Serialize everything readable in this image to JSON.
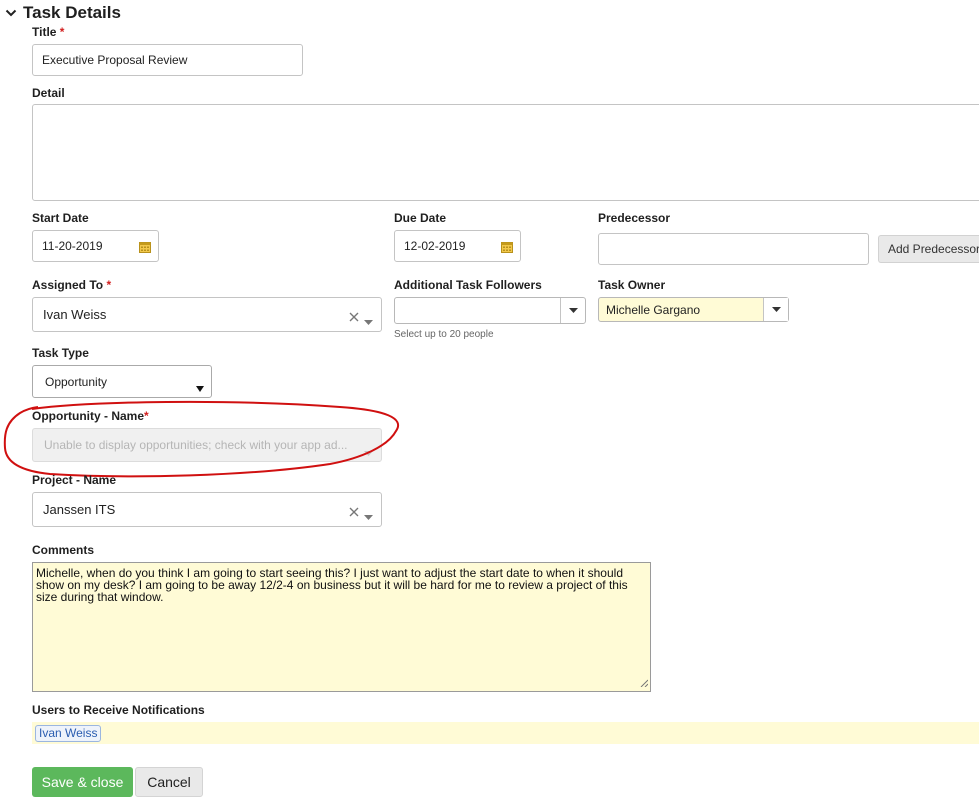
{
  "section": {
    "title": "Task Details"
  },
  "required_mark": "*",
  "title_field": {
    "label": "Title",
    "value": "Executive Proposal Review"
  },
  "detail_field": {
    "label": "Detail",
    "value": ""
  },
  "start_date": {
    "label": "Start Date",
    "value": "11-20-2019"
  },
  "due_date": {
    "label": "Due Date",
    "value": "12-02-2019"
  },
  "predecessor": {
    "label": "Predecessor",
    "value": "",
    "add_button": "Add Predecessors"
  },
  "assigned_to": {
    "label": "Assigned To",
    "value": "Ivan Weiss"
  },
  "followers": {
    "label": "Additional Task Followers",
    "hint": "Select up to 20 people"
  },
  "task_owner": {
    "label": "Task Owner",
    "value": "Michelle Gargano"
  },
  "task_type": {
    "label": "Task Type",
    "value": "Opportunity"
  },
  "opportunity": {
    "label": "Opportunity - Name",
    "placeholder": "Unable to display opportunities; check with your app ad..."
  },
  "project": {
    "label": "Project - Name",
    "value": "Janssen ITS"
  },
  "comments": {
    "label": "Comments",
    "value": "Michelle, when do you think I am going to start seeing this?  I just want to adjust the start date to when it should show on my desk?  I am going to be away 12/2-4 on business but it will be hard for me to review a project of this size during that window."
  },
  "notifications": {
    "label": "Users to Receive Notifications",
    "users": [
      "Ivan Weiss"
    ]
  },
  "buttons": {
    "save": "Save & close",
    "cancel": "Cancel"
  },
  "colors": {
    "save_green": "#5cb85c",
    "highlight_yellow": "#fffbd6",
    "annotation_red": "#d01010",
    "required_red": "#d21f1f"
  },
  "icons": {
    "collapse": "chevron-down-icon",
    "calendar": "calendar-icon",
    "clear": "clear-x-icon",
    "dropdown": "caret-down-icon"
  }
}
